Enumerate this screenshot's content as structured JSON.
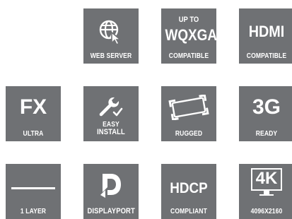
{
  "colors": {
    "tile": "#6f7174",
    "text": "#ffffff"
  },
  "tiles": [
    {
      "icon": "globe-cursor-icon",
      "caption": "WEB SERVER"
    },
    {
      "pre": "UP TO",
      "big": "WQXGA",
      "caption": "COMPATIBLE"
    },
    {
      "big": "HDMI",
      "caption": "COMPATIBLE"
    },
    {
      "big": "FX",
      "caption": "ULTRA"
    },
    {
      "icon": "wrench-check-icon",
      "caption_line1": "EASY",
      "caption_line2": "INSTALL"
    },
    {
      "icon": "rugged-frame-icon",
      "caption": "RUGGED"
    },
    {
      "big": "3G",
      "caption": "READY"
    },
    {
      "icon": "horizontal-line-icon",
      "caption": "1 LAYER"
    },
    {
      "icon": "displayport-logo-icon",
      "caption": "DISPLAYPORT"
    },
    {
      "big": "HDCP",
      "caption": "COMPLIANT"
    },
    {
      "big": "4K",
      "caption": "4096X2160"
    }
  ]
}
